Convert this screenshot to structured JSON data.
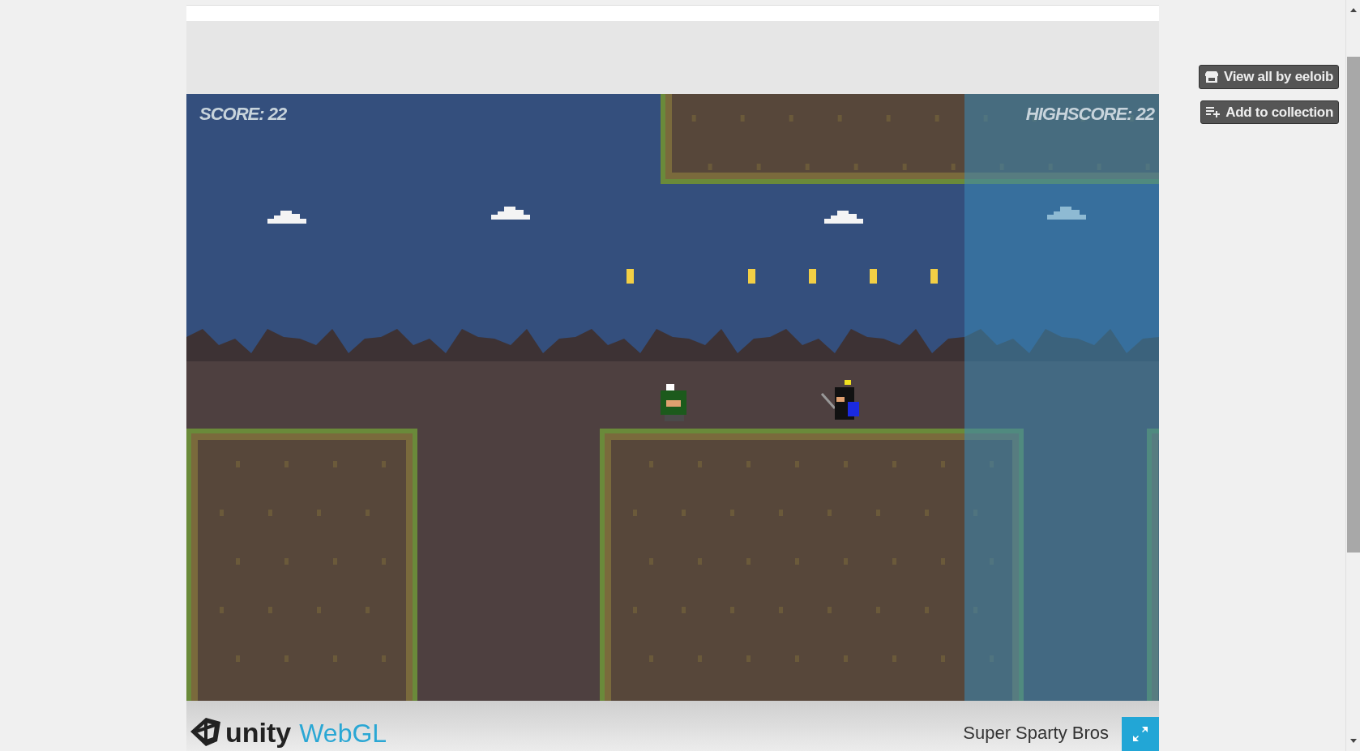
{
  "game": {
    "score": "SCORE: 22",
    "highscore": "HIGHSCORE: 22"
  },
  "sidebar_buttons": [
    {
      "kind": "view-all",
      "label": "View all by eeloib"
    },
    {
      "kind": "collection",
      "label": "Add to collection"
    }
  ],
  "footer": {
    "brand": "unity",
    "platform": "WebGL",
    "title": "Super Sparty Bros"
  }
}
